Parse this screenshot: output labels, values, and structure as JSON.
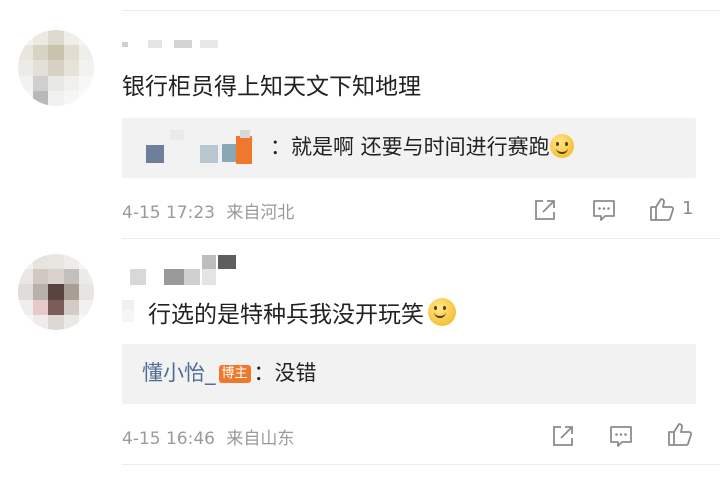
{
  "comments": [
    {
      "text": "银行柜员得上知天文下知地理",
      "reply": {
        "user": "",
        "text": "：就是啊 还要与时间进行赛跑"
      },
      "time": "4-15 17:23",
      "location": "来自河北",
      "like_count": "1"
    },
    {
      "text": "行选的是特种兵我没开玩笑",
      "reply": {
        "user": "懂小怡_",
        "badge": "博主",
        "text": "：没错"
      },
      "time": "4-15 16:46",
      "location": "来自山东",
      "like_count": ""
    }
  ],
  "icons": {
    "share": "share-icon",
    "comment": "comment-icon",
    "like": "thumbs-up-icon",
    "emoji": "smile-emoji-icon"
  },
  "colors": {
    "reply_user": "#4f6d99",
    "badge": "#f0782d",
    "meta": "#9a9a9a"
  }
}
